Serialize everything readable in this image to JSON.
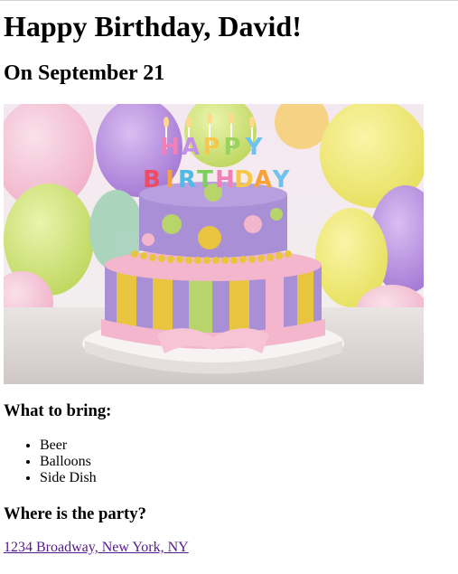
{
  "page": {
    "title": "Happy Birthday, David!",
    "date": "On September 21"
  },
  "hero_image": {
    "description_icon": "birthday-cake-image",
    "candle_letters": [
      "H",
      "A",
      "P",
      "P",
      "Y",
      "B",
      "I",
      "R",
      "T",
      "H",
      "D",
      "A",
      "Y"
    ]
  },
  "bring": {
    "heading": "What to bring:",
    "items": [
      "Beer",
      "Balloons",
      "Side Dish"
    ]
  },
  "party": {
    "heading": "Where is the party?",
    "address": "1234 Broadway, New York, NY"
  },
  "colors": {
    "link_visited": "#551a8b",
    "cake_purple": "#a98fd6",
    "cake_pink": "#f4b6cc",
    "cake_yellow": "#e9c53f",
    "cake_green": "#b7d56a"
  }
}
